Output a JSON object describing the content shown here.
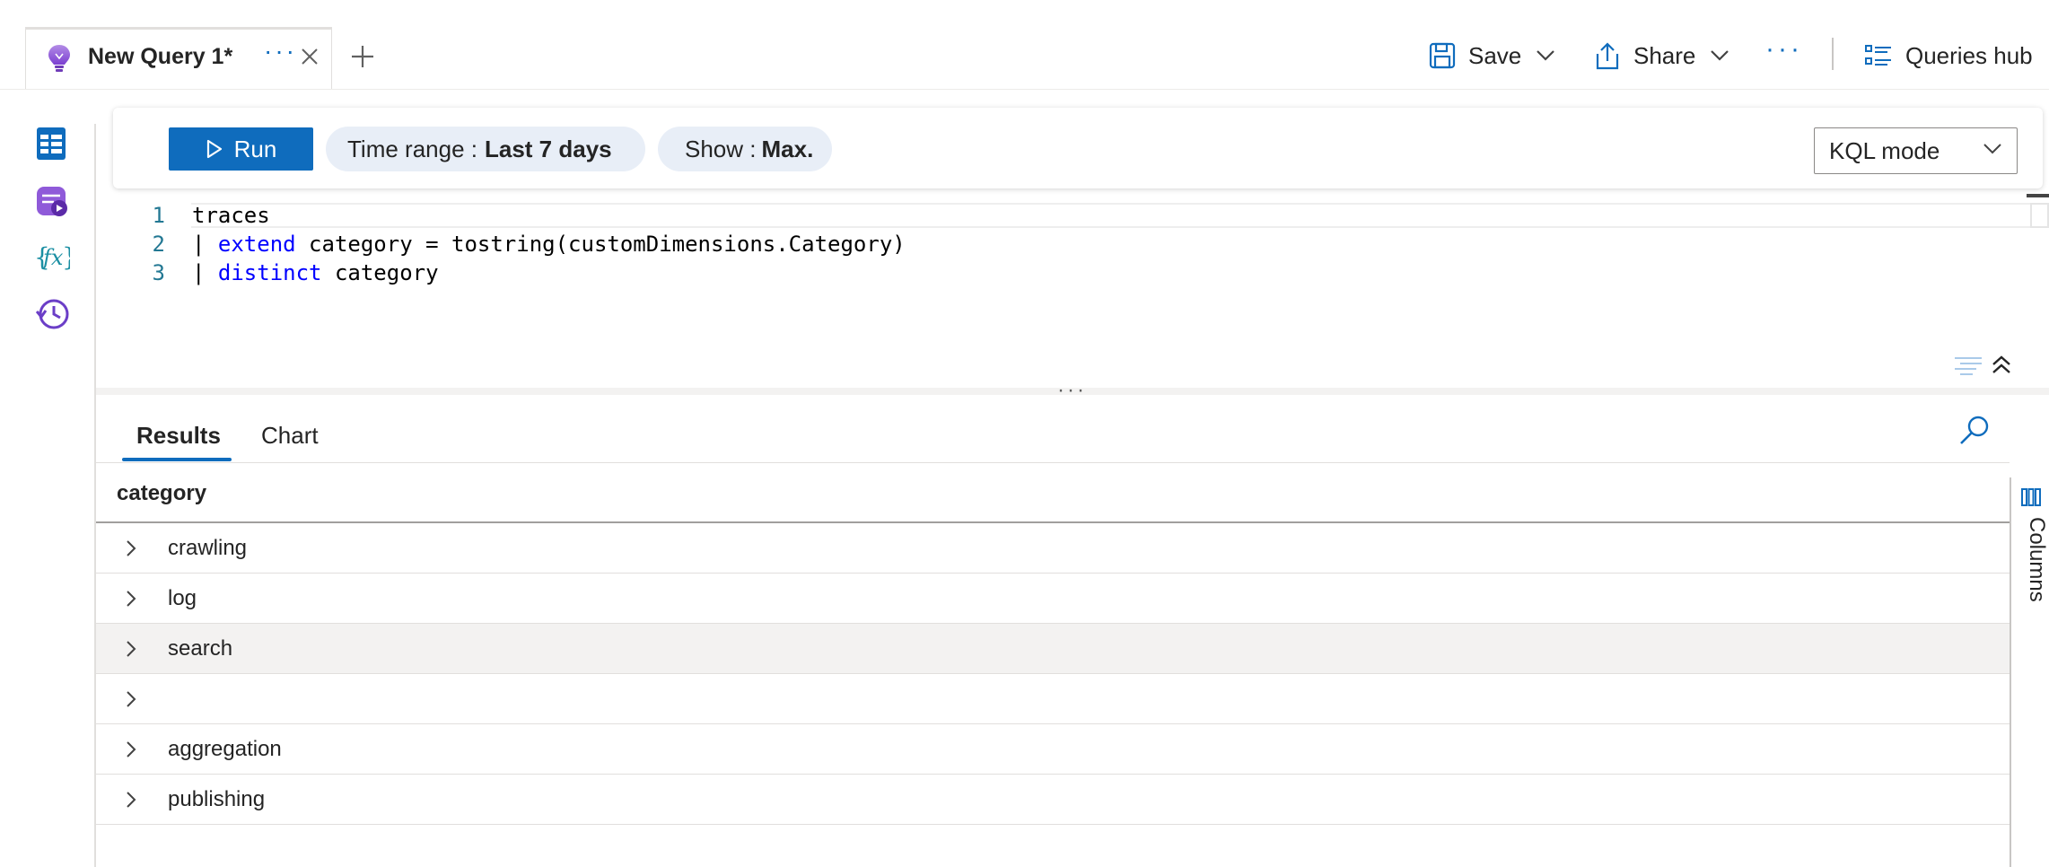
{
  "tab": {
    "title": "New Query 1*",
    "more": "···"
  },
  "commands": {
    "save": "Save",
    "share": "Share",
    "more": "···",
    "queries_hub": "Queries hub"
  },
  "toolbar": {
    "run": "Run",
    "time_range_label": "Time range :",
    "time_range_value": "Last 7 days",
    "show_label": "Show :",
    "show_value": "Max.",
    "mode": "KQL mode"
  },
  "editor": {
    "line_numbers": [
      "1",
      "2",
      "3"
    ],
    "lines": [
      {
        "plain": "traces"
      },
      {
        "pipe": "| ",
        "kw": "extend",
        "rest": " category = tostring(customDimensions.Category)"
      },
      {
        "pipe": "| ",
        "kw": "distinct",
        "rest": " category"
      }
    ]
  },
  "splitter": "···",
  "results": {
    "tabs": [
      "Results",
      "Chart"
    ],
    "column_header": "category",
    "rows": [
      "crawling",
      "log",
      "search",
      "",
      "aggregation",
      "publishing"
    ],
    "side_panel": "Columns"
  },
  "colors": {
    "accent": "#0f6cbd",
    "keyword": "#0000ff",
    "line_number": "#237893",
    "pill_bg": "#e8eef7",
    "row_hover": "#f3f2f1"
  }
}
